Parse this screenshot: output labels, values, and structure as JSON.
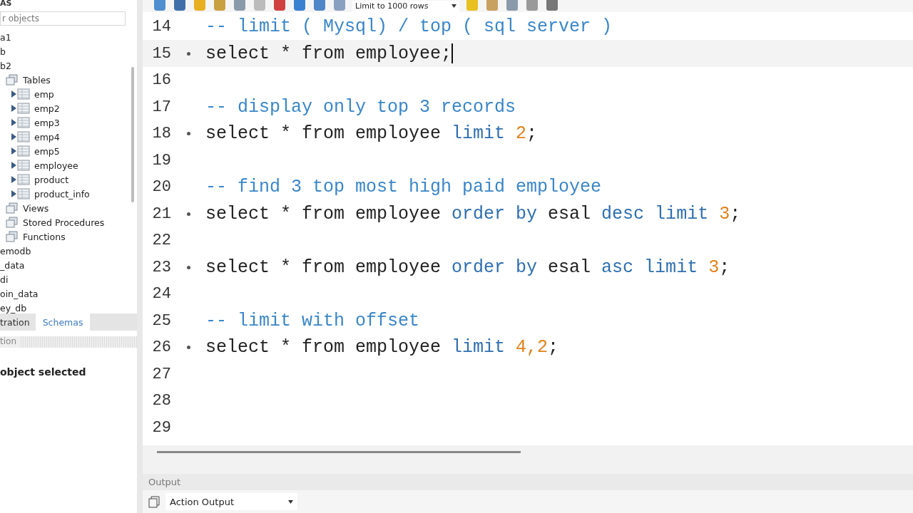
{
  "sidebar": {
    "title": "AS",
    "filter": {
      "placeholder": "r objects"
    },
    "tree": [
      {
        "label": "a1"
      },
      {
        "label": "b"
      },
      {
        "label": "b2",
        "children": [
          {
            "label": "Tables",
            "kind": "folder",
            "children": [
              {
                "label": "emp",
                "kind": "table",
                "expanded": false
              },
              {
                "label": "emp2",
                "kind": "table",
                "expanded": false
              },
              {
                "label": "emp3",
                "kind": "table",
                "expanded": false
              },
              {
                "label": "emp4",
                "kind": "table",
                "expanded": false
              },
              {
                "label": "emp5",
                "kind": "table",
                "expanded": false
              },
              {
                "label": "employee",
                "kind": "table",
                "expanded": false
              },
              {
                "label": "product",
                "kind": "table",
                "expanded": false
              },
              {
                "label": "product_info",
                "kind": "table",
                "expanded": false
              }
            ]
          },
          {
            "label": "Views",
            "kind": "folder"
          },
          {
            "label": "Stored Procedures",
            "kind": "folder"
          },
          {
            "label": "Functions",
            "kind": "folder"
          }
        ]
      },
      {
        "label": "emodb"
      },
      {
        "label": "_data"
      },
      {
        "label": "di"
      },
      {
        "label": "oin_data"
      },
      {
        "label": "ey_db"
      }
    ],
    "tabs": [
      {
        "label": "tration",
        "selected": false
      },
      {
        "label": "Schemas",
        "selected": true
      }
    ],
    "info": {
      "header": "tion",
      "message": "object selected"
    }
  },
  "toolbar": {
    "limit": "Limit to 1000 rows"
  },
  "editor": {
    "lines": [
      {
        "number": "14",
        "executable": false,
        "current": false,
        "tokens": [
          {
            "kind": "comment",
            "text": "-- limit ( Mysql) / top ( sql server )"
          }
        ]
      },
      {
        "number": "15",
        "executable": true,
        "current": true,
        "tokens": [
          {
            "kind": "plain",
            "text": "select * from employee;"
          }
        ]
      },
      {
        "number": "16",
        "executable": false,
        "current": false
      },
      {
        "number": "17",
        "executable": false,
        "current": false,
        "tokens": [
          {
            "kind": "comment",
            "text": "-- display only top 3 records"
          }
        ]
      },
      {
        "number": "18",
        "executable": true,
        "current": false,
        "tokens": [
          {
            "kind": "plain",
            "text": "select * from employee "
          },
          {
            "kind": "keyword",
            "text": "limit "
          },
          {
            "kind": "number",
            "text": "2"
          },
          {
            "kind": "plain",
            "text": ";"
          }
        ]
      },
      {
        "number": "19",
        "executable": false,
        "current": false
      },
      {
        "number": "20",
        "executable": false,
        "current": false,
        "tokens": [
          {
            "kind": "comment",
            "text": "-- find 3 top most high paid employee"
          }
        ]
      },
      {
        "number": "21",
        "executable": true,
        "current": false,
        "tokens": [
          {
            "kind": "plain",
            "text": "select * from employee "
          },
          {
            "kind": "keyword",
            "text": "order by "
          },
          {
            "kind": "plain",
            "text": "esal "
          },
          {
            "kind": "keyword",
            "text": "desc limit "
          },
          {
            "kind": "number",
            "text": "3"
          },
          {
            "kind": "plain",
            "text": ";"
          }
        ]
      },
      {
        "number": "22",
        "executable": false,
        "current": false
      },
      {
        "number": "23",
        "executable": true,
        "current": false,
        "tokens": [
          {
            "kind": "plain",
            "text": "select * from employee "
          },
          {
            "kind": "keyword",
            "text": "order by "
          },
          {
            "kind": "plain",
            "text": "esal "
          },
          {
            "kind": "keyword",
            "text": "asc limit "
          },
          {
            "kind": "number",
            "text": "3"
          },
          {
            "kind": "plain",
            "text": ";"
          }
        ]
      },
      {
        "number": "24",
        "executable": false,
        "current": false
      },
      {
        "number": "25",
        "executable": false,
        "current": false,
        "tokens": [
          {
            "kind": "comment",
            "text": "-- limit with offset"
          }
        ]
      },
      {
        "number": "26",
        "executable": true,
        "current": false,
        "tokens": [
          {
            "kind": "plain",
            "text": "select * from employee "
          },
          {
            "kind": "keyword",
            "text": "limit "
          },
          {
            "kind": "number",
            "text": "4,2"
          },
          {
            "kind": "plain",
            "text": ";"
          }
        ]
      },
      {
        "number": "27",
        "executable": false,
        "current": false
      },
      {
        "number": "28",
        "executable": false,
        "current": false
      },
      {
        "number": "29",
        "executable": false,
        "current": false
      }
    ]
  },
  "output": {
    "title": "Output",
    "selector": "Action Output"
  }
}
